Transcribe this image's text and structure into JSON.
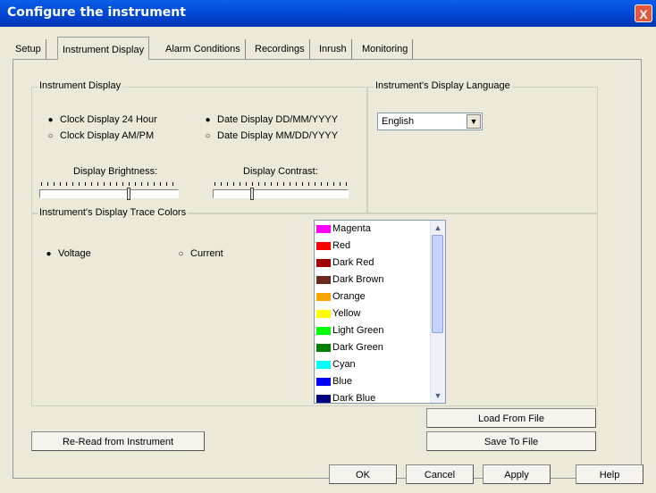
{
  "window": {
    "title": "Configure the instrument",
    "close_label": "X"
  },
  "tabs": [
    {
      "label": "Setup"
    },
    {
      "label": "Instrument Display"
    },
    {
      "label": "Alarm Conditions"
    },
    {
      "label": "Recordings"
    },
    {
      "label": "Inrush"
    },
    {
      "label": "Monitoring"
    }
  ],
  "instrument_display": {
    "group_label": "Instrument Display",
    "clock_24": "Clock Display 24 Hour",
    "clock_ampm": "Clock Display AM/PM",
    "date_ddmm": "Date Display DD/MM/YYYY",
    "date_mmdd": "Date Display MM/DD/YYYY",
    "brightness_label": "Display Brightness:",
    "contrast_label": "Display Contrast:"
  },
  "language": {
    "group_label": "Instrument's Display Language",
    "value": "English"
  },
  "trace_colors": {
    "group_label": "Instrument's Display Trace Colors",
    "voltage": "Voltage",
    "current": "Current",
    "items": [
      {
        "label": "Magenta",
        "color": "#ff00ff"
      },
      {
        "label": "Red",
        "color": "#ff0000"
      },
      {
        "label": "Dark Red",
        "color": "#a00000"
      },
      {
        "label": "Dark Brown",
        "color": "#6b2a20"
      },
      {
        "label": "Orange",
        "color": "#f7a500"
      },
      {
        "label": "Yellow",
        "color": "#ffff00"
      },
      {
        "label": "Light Green",
        "color": "#00ff00"
      },
      {
        "label": "Dark Green",
        "color": "#008000"
      },
      {
        "label": "Cyan",
        "color": "#00ffff"
      },
      {
        "label": "Blue",
        "color": "#0000ff"
      },
      {
        "label": "Dark Blue",
        "color": "#000080"
      }
    ]
  },
  "buttons": {
    "load": "Load From File",
    "save": "Save To File",
    "reread": "Re-Read from Instrument",
    "ok": "OK",
    "cancel": "Cancel",
    "apply": "Apply",
    "help": "Help"
  }
}
